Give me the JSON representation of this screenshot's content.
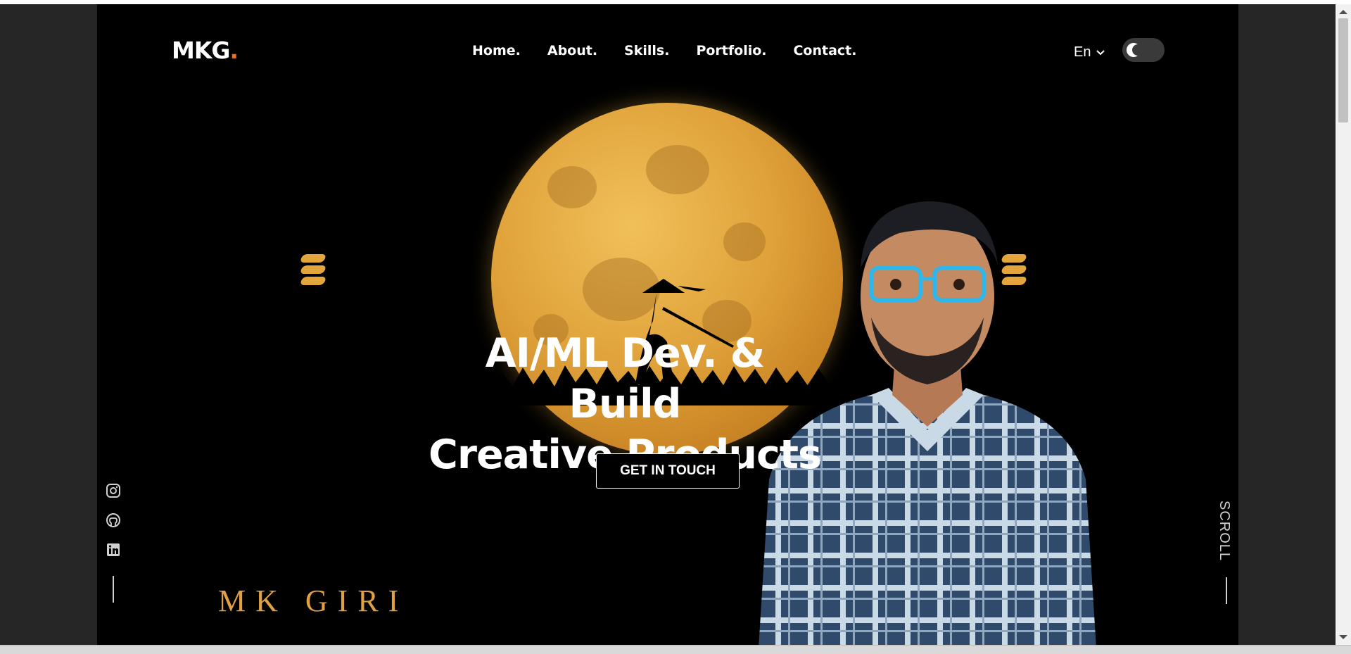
{
  "brand": {
    "logo_text": "MKG",
    "logo_dot": "."
  },
  "nav": {
    "items": [
      "Home.",
      "About.",
      "Skills.",
      "Portfolio.",
      "Contact."
    ]
  },
  "lang": {
    "selected": "En"
  },
  "theme_toggle": {
    "mode": "dark"
  },
  "hero": {
    "line1": "AI/ML Dev. & Build",
    "line2": "Creative Products",
    "cta_label": "GET IN TOUCH"
  },
  "social": {
    "icons": [
      "instagram-icon",
      "github-icon",
      "linkedin-icon"
    ]
  },
  "signature": "MK GIRI",
  "scroll_label": "SCROLL",
  "colors": {
    "accent": "#e8712c",
    "moon": "#e0a23a",
    "background": "#000000"
  }
}
